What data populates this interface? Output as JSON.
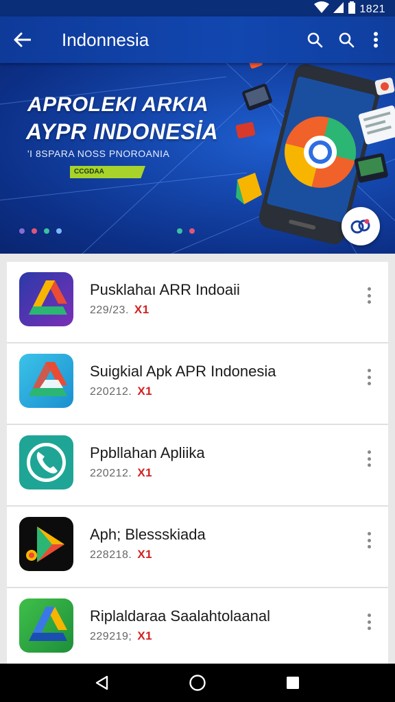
{
  "status_bar": {
    "time": "1821"
  },
  "app_bar": {
    "title": "Indonnesia"
  },
  "banner": {
    "headline_1": "APROLEKI ARKIA",
    "headline_2": "AYPR  INDONESİA",
    "subtitle": "'I 8SPARA NOSS PNOROANIA",
    "chip": "CCGDAA"
  },
  "apps": [
    {
      "title": "Pusklahaı ARR Indoaii",
      "date": "229/23.",
      "badge": "X1",
      "icon": "drive-style-icon"
    },
    {
      "title": "Suigkial Apk APR Indonesia",
      "date": "220212.",
      "badge": "X1",
      "icon": "drive-style-icon"
    },
    {
      "title": "Ppbllahan Apliika",
      "date": "220212.",
      "badge": "X1",
      "icon": "phone-icon"
    },
    {
      "title": "Aph; Blessskiada",
      "date": "228218.",
      "badge": "X1",
      "icon": "play-style-icon"
    },
    {
      "title": "Riplaldaraa Saalahtolaanal",
      "date": "229219;",
      "badge": "X1",
      "icon": "drive-style-icon"
    }
  ],
  "colors": {
    "primary": "#1247b0",
    "badge": "#d32020",
    "chip": "#a8d32a"
  }
}
